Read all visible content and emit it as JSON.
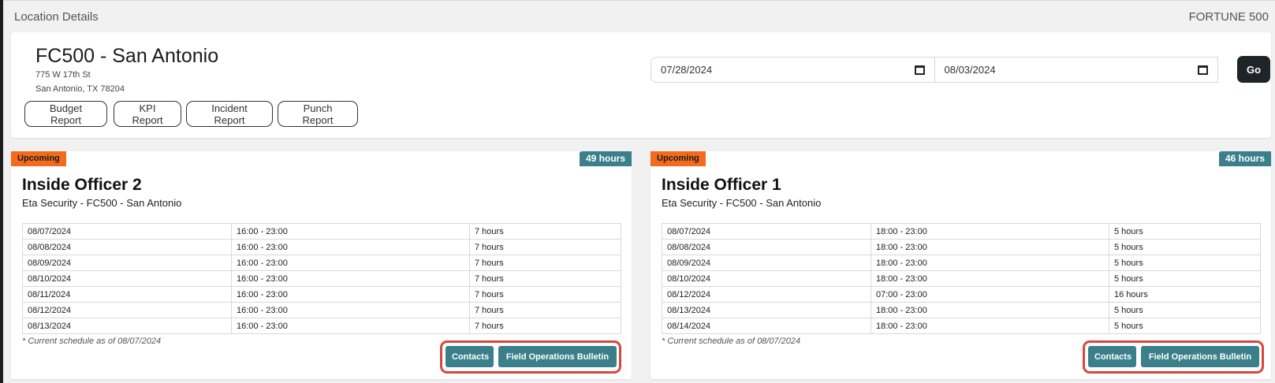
{
  "topbar": {
    "title": "Location Details",
    "brand": "FORTUNE 500"
  },
  "location": {
    "name": "FC500 - San Antonio",
    "address_line1": "775 W 17th St",
    "address_line2": "San Antonio, TX 78204"
  },
  "reports": {
    "budget": "Budget Report",
    "kpi": "KPI Report",
    "incident": "Incident Report",
    "punch": "Punch Report"
  },
  "date_range": {
    "start": "07/28/2024",
    "end": "08/03/2024",
    "go_label": "Go"
  },
  "shifts": [
    {
      "status": "Upcoming",
      "total_hours": "49 hours",
      "title": "Inside Officer 2",
      "subtitle": "Eta Security - FC500 - San Antonio",
      "rows": [
        [
          "08/07/2024",
          "16:00 - 23:00",
          "7 hours"
        ],
        [
          "08/08/2024",
          "16:00 - 23:00",
          "7 hours"
        ],
        [
          "08/09/2024",
          "16:00 - 23:00",
          "7 hours"
        ],
        [
          "08/10/2024",
          "16:00 - 23:00",
          "7 hours"
        ],
        [
          "08/11/2024",
          "16:00 - 23:00",
          "7 hours"
        ],
        [
          "08/12/2024",
          "16:00 - 23:00",
          "7 hours"
        ],
        [
          "08/13/2024",
          "16:00 - 23:00",
          "7 hours"
        ]
      ],
      "note": "* Current schedule as of 08/07/2024",
      "contacts_label": "Contacts",
      "bulletin_label": "Field Operations Bulletin"
    },
    {
      "status": "Upcoming",
      "total_hours": "46 hours",
      "title": "Inside Officer 1",
      "subtitle": "Eta Security - FC500 - San Antonio",
      "rows": [
        [
          "08/07/2024",
          "18:00 - 23:00",
          "5 hours"
        ],
        [
          "08/08/2024",
          "18:00 - 23:00",
          "5 hours"
        ],
        [
          "08/09/2024",
          "18:00 - 23:00",
          "5 hours"
        ],
        [
          "08/10/2024",
          "18:00 - 23:00",
          "5 hours"
        ],
        [
          "08/12/2024",
          "07:00 - 23:00",
          "16 hours"
        ],
        [
          "08/13/2024",
          "18:00 - 23:00",
          "5 hours"
        ],
        [
          "08/14/2024",
          "18:00 - 23:00",
          "5 hours"
        ]
      ],
      "note": "* Current schedule as of 08/07/2024",
      "contacts_label": "Contacts",
      "bulletin_label": "Field Operations Bulletin"
    }
  ],
  "colors": {
    "accent_teal": "#3b7f8b",
    "upcoming_orange": "#f26b1c",
    "highlight_red": "#d9473c"
  }
}
